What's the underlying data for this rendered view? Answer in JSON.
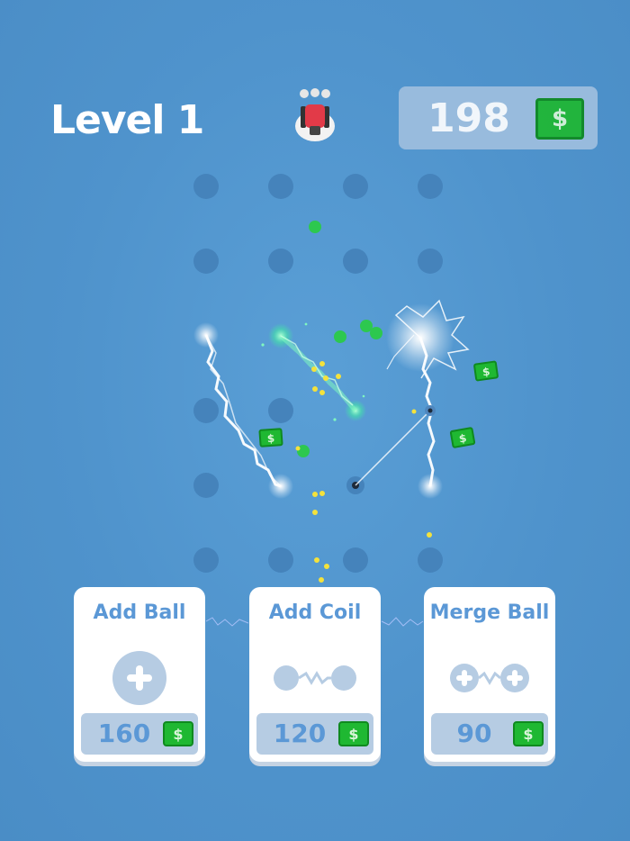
{
  "header": {
    "level_label": "Level 1",
    "money": "198",
    "money_icon": "cash-icon"
  },
  "board": {
    "peg_color": "#4583bb",
    "coil_color": "#ffffff",
    "green_coil_color": "#3ff0a0",
    "ball_color": "#2dc84f",
    "coin_color": "#f4e23c"
  },
  "shop": {
    "cards": [
      {
        "title": "Add Ball",
        "price": "160",
        "icon": "plus-icon"
      },
      {
        "title": "Add Coil",
        "price": "120",
        "icon": "coil-icon"
      },
      {
        "title": "Merge Ball",
        "price": "90",
        "icon": "merge-icon"
      }
    ]
  },
  "colors": {
    "accent": "#5b98d6",
    "cash_green": "#1fb832",
    "card_bg": "#ffffff"
  }
}
